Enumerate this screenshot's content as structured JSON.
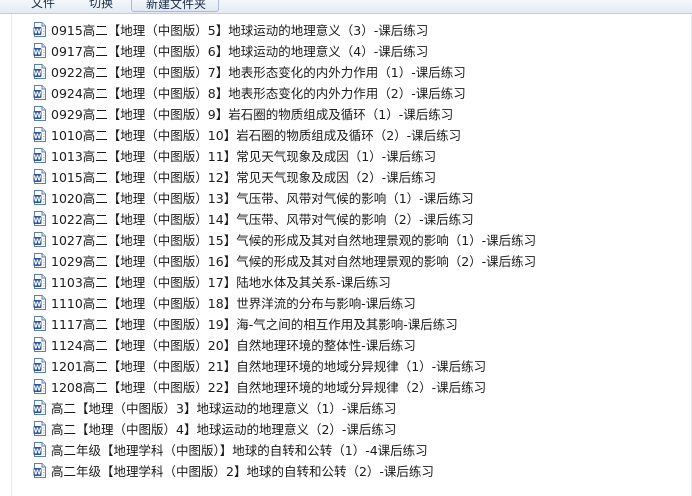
{
  "toolbar": {
    "buttons": [
      {
        "label": "文件"
      },
      {
        "label": "切换"
      },
      {
        "label": "新建文件夹"
      }
    ]
  },
  "files": [
    {
      "name": "0915高二【地理（中图版）5】地球运动的地理意义（3）-课后练习",
      "icon": "word-document-icon"
    },
    {
      "name": "0917高二【地理（中图版）6】地球运动的地理意义（4）-课后练习",
      "icon": "word-document-icon"
    },
    {
      "name": "0922高二【地理（中图版）7】地表形态变化的内外力作用（1）-课后练习",
      "icon": "word-document-icon"
    },
    {
      "name": "0924高二【地理（中图版）8】地表形态变化的内外力作用（2）-课后练习",
      "icon": "word-document-icon"
    },
    {
      "name": "0929高二【地理（中图版）9】岩石圈的物质组成及循环（1）-课后练习",
      "icon": "word-document-icon"
    },
    {
      "name": "1010高二【地理（中图版）10】岩石圈的物质组成及循环（2）-课后练习",
      "icon": "word-document-icon"
    },
    {
      "name": "1013高二【地理（中图版）11】常见天气现象及成因（1）-课后练习",
      "icon": "word-document-icon"
    },
    {
      "name": "1015高二【地理（中图版）12】常见天气现象及成因（2）-课后练习",
      "icon": "word-document-icon"
    },
    {
      "name": "1020高二【地理（中图版）13】气压带、风带对气候的影响（1）-课后练习",
      "icon": "word-document-icon"
    },
    {
      "name": "1022高二【地理（中图版）14】气压带、风带对气候的影响（2）-课后练习",
      "icon": "word-document-icon"
    },
    {
      "name": "1027高二【地理（中图版）15】气候的形成及其对自然地理景观的影响（1）-课后练习",
      "icon": "word-document-icon"
    },
    {
      "name": "1029高二【地理（中图版）16】气候的形成及其对自然地理景观的影响（2）-课后练习",
      "icon": "word-document-icon"
    },
    {
      "name": "1103高二【地理（中图版）17】陆地水体及其关系-课后练习",
      "icon": "word-document-icon"
    },
    {
      "name": "1110高二【地理（中图版）18】世界洋流的分布与影响-课后练习",
      "icon": "word-document-icon"
    },
    {
      "name": "1117高二【地理（中图版）19】海-气之间的相互作用及其影响-课后练习",
      "icon": "word-document-icon"
    },
    {
      "name": "1124高二【地理（中图版）20】自然地理环境的整体性-课后练习",
      "icon": "word-document-icon"
    },
    {
      "name": "1201高二【地理（中图版）21】自然地理环境的地域分异规律（1）-课后练习",
      "icon": "word-document-icon"
    },
    {
      "name": "1208高二【地理（中图版）22】自然地理环境的地域分异规律（2）-课后练习",
      "icon": "word-document-icon"
    },
    {
      "name": "高二【地理（中图版）3】地球运动的地理意义（1）-课后练习",
      "icon": "word-document-icon"
    },
    {
      "name": "高二【地理（中图版）4】地球运动的地理意义（2）-课后练习",
      "icon": "word-document-icon"
    },
    {
      "name": "高二年级【地理学科（中图版）】地球的自转和公转（1）-4课后练习",
      "icon": "word-document-icon"
    },
    {
      "name": "高二年级【地理学科（中图版）2】地球的自转和公转（2）-课后练习",
      "icon": "word-document-icon"
    }
  ],
  "colors": {
    "word_icon_blue": "#2b5797",
    "word_icon_light": "#dce8f7"
  }
}
